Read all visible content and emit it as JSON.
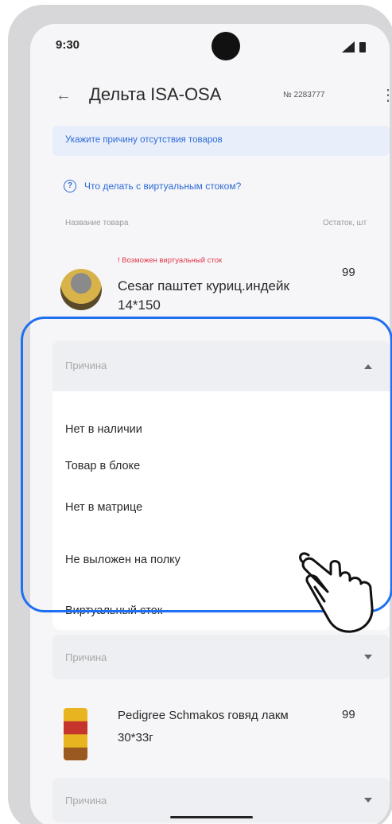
{
  "status_bar": {
    "time": "9:30"
  },
  "app_bar": {
    "title": "Дельта ISA-OSA",
    "doc_number": "№ 2283777"
  },
  "banner": {
    "text": "Укажите причину отсутствия товаров"
  },
  "help": {
    "text": "Что делать с виртуальным стоком?"
  },
  "table_header": {
    "name": "Название товара",
    "stock": "Остаток, шт"
  },
  "products": [
    {
      "warning": "! Возможен виртуальный сток",
      "name": "Cesar паштет куриц.индейк 14*150",
      "qty": "99",
      "reason_placeholder": "Причина",
      "reason_options": [
        "Нет в наличии",
        "Товар в блоке",
        "Нет в матрице",
        "Не выложен на полку",
        "Виртуальный сток"
      ]
    },
    {
      "reason_placeholder": "Причина"
    },
    {
      "name": "Pedigree Schmakos говяд лакм 30*33г",
      "qty": "99",
      "reason_placeholder": "Причина"
    }
  ],
  "colors": {
    "accent": "#2e6bd6",
    "warning": "#e2384b",
    "highlight": "#1f6ff2"
  }
}
